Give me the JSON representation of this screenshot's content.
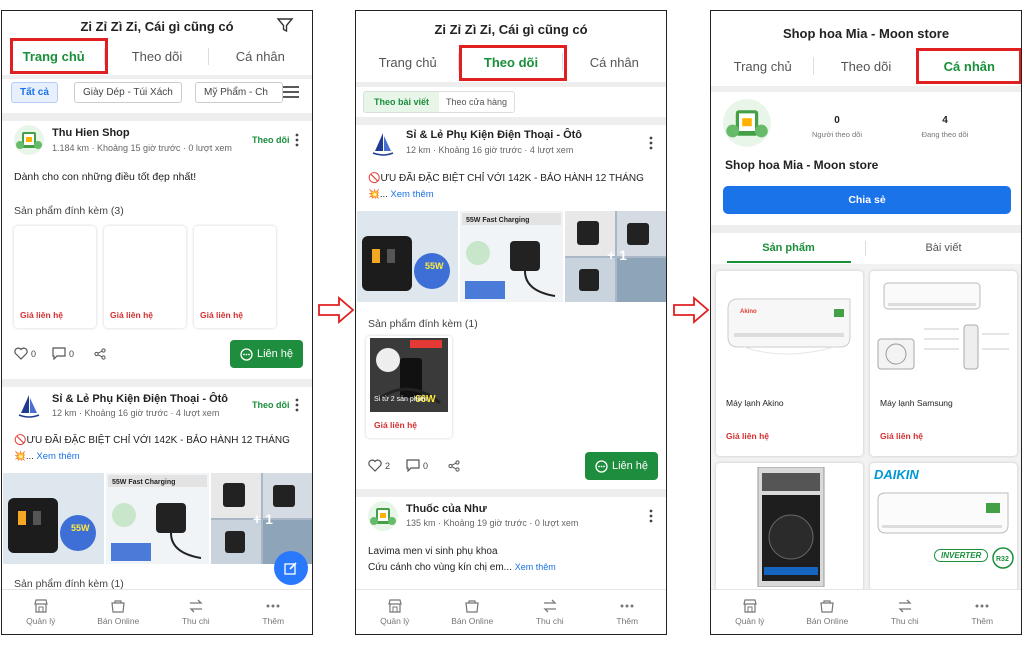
{
  "screen1": {
    "title": "Zi Zỉ Zì Zi, Cái gì cũng có",
    "tabs": [
      "Trang chủ",
      "Theo dõi",
      "Cá nhân"
    ],
    "filters": [
      "Tất cả",
      "Giày Dép - Túi Xách",
      "Mỹ Phẩm - Ch"
    ],
    "post1": {
      "shop": "Thu Hien Shop",
      "meta": "1.184 km · Khoảng 15 giờ trước · 0 lượt xem",
      "follow": "Theo dõi",
      "text": "Dành cho con những điều tốt đẹp nhất!",
      "attached": "Sản phẩm đính kèm (3)",
      "prices": [
        "Giá liên hệ",
        "Giá liên hệ",
        "Giá liên hệ"
      ],
      "likes": "0",
      "comments": "0",
      "contact": "Liên hệ"
    },
    "post2": {
      "shop": "Sỉ & Lẻ Phụ Kiện Điện Thoại - Ôtô",
      "meta": "12 km · Khoảng 16 giờ trước · 4 lượt xem",
      "follow": "Theo dõi",
      "text": "ƯU ĐÃI ĐẶC BIỆT CHỈ VỚI 142K - BẢO HÀNH 12 THÁNG",
      "see_more": "Xem thêm",
      "more_count": "+ 1",
      "attached": "Sản phẩm đính kèm (1)"
    }
  },
  "screen2": {
    "title": "Zi Zỉ Zì Zi, Cái gì cũng có",
    "tabs": [
      "Trang chủ",
      "Theo dõi",
      "Cá nhân"
    ],
    "subtabs": [
      "Theo bài viết",
      "Theo cửa hàng"
    ],
    "post1": {
      "shop": "Sỉ & Lẻ Phụ Kiện Điện Thoại - Ôtô",
      "meta": "12 km · Khoảng 16 giờ trước · 4 lượt xem",
      "text": "ƯU ĐÃI ĐẶC BIỆT CHỈ VỚI 142K - BẢO HÀNH 12 THÁNG",
      "see_more": "Xem thêm",
      "more_count": "+ 1",
      "attached": "Sản phẩm đính kèm (1)",
      "product_caption": "Sỉ từ 2 sản phẩm",
      "price": "Giá liên hệ",
      "likes": "2",
      "comments": "0",
      "contact": "Liên hệ"
    },
    "post2": {
      "shop": "Thuốc của Như",
      "meta": "135 km · Khoảng 19 giờ trước · 0 lượt xem",
      "line1": "Lavima men vi sinh phụ khoa",
      "line2": "Cứu cánh cho vùng kín chị em...",
      "see_more": "Xem thêm"
    }
  },
  "screen3": {
    "title": "Shop hoa Mia - Moon store",
    "tabs": [
      "Trang chủ",
      "Theo dõi",
      "Cá nhân"
    ],
    "followers_count": "0",
    "followers_label": "Người theo dõi",
    "following_count": "4",
    "following_label": "Đang theo dõi",
    "shop_name": "Shop hoa Mia - Moon store",
    "share": "Chia sẻ",
    "subtabs": [
      "Sản phẩm",
      "Bài viết"
    ],
    "products": [
      {
        "name": "Máy lạnh Akino",
        "price": "Giá liên hệ"
      },
      {
        "name": "Máy lạnh Samsung",
        "price": "Giá liên hệ"
      }
    ],
    "brand_logo": "DAIKIN",
    "brand_badge": "INVERTER"
  },
  "nav": [
    "Quản lý",
    "Bán Online",
    "Thu chi",
    "Thêm"
  ],
  "colors": {
    "green": "#1a8f3a",
    "red_highlight": "#e02020",
    "blue": "#1a73e8",
    "price_red": "#d32f2f"
  }
}
